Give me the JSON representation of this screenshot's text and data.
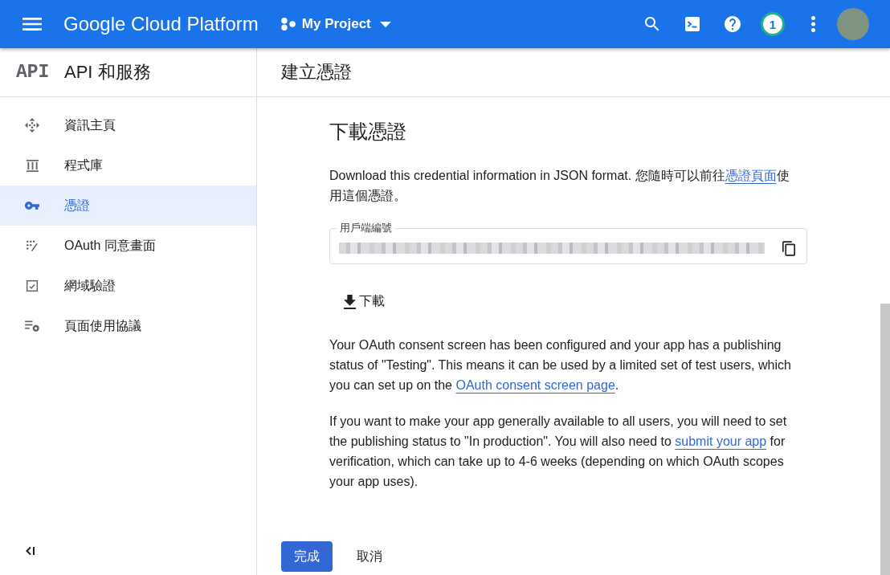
{
  "top_bar": {
    "product_name": "Google Cloud Platform",
    "project": "My Project",
    "notification_count": "1"
  },
  "sidebar": {
    "logo": "API",
    "title": "API 和服務",
    "items": [
      {
        "label": "資訊主頁",
        "selected": false
      },
      {
        "label": "程式庫",
        "selected": false
      },
      {
        "label": "憑證",
        "selected": true
      },
      {
        "label": "OAuth 同意畫面",
        "selected": false
      },
      {
        "label": "網域驗證",
        "selected": false
      },
      {
        "label": "頁面使用協議",
        "selected": false
      }
    ]
  },
  "main": {
    "title": "建立憑證",
    "section_title": "下載憑證",
    "intro": {
      "text": "Download this credential information in JSON format. 您隨時可以前往",
      "link": "憑證頁面",
      "after": "使用這個憑證。"
    },
    "client_id_field": {
      "label": "用戶端編號",
      "redacted": true
    },
    "download_button": "下載",
    "notices": [
      {
        "text": "Your OAuth consent screen has been configured and your app has a publishing status of \"Testing\". This means it can be used by a limited set of test users, which you can set up on the ",
        "link": "OAuth consent screen page",
        "after": "."
      },
      {
        "text": "If you want to make your app generally available to all users, you will need to set the publishing status to \"In production\". You will also need to ",
        "link": "submit your app",
        "after": " for verification, which can take up to 4-6 weeks (depending on which OAuth scopes your app uses)."
      }
    ],
    "buttons": [
      {
        "label": "完成",
        "kind": "primary"
      },
      {
        "label": "取消",
        "kind": "text"
      }
    ]
  }
}
